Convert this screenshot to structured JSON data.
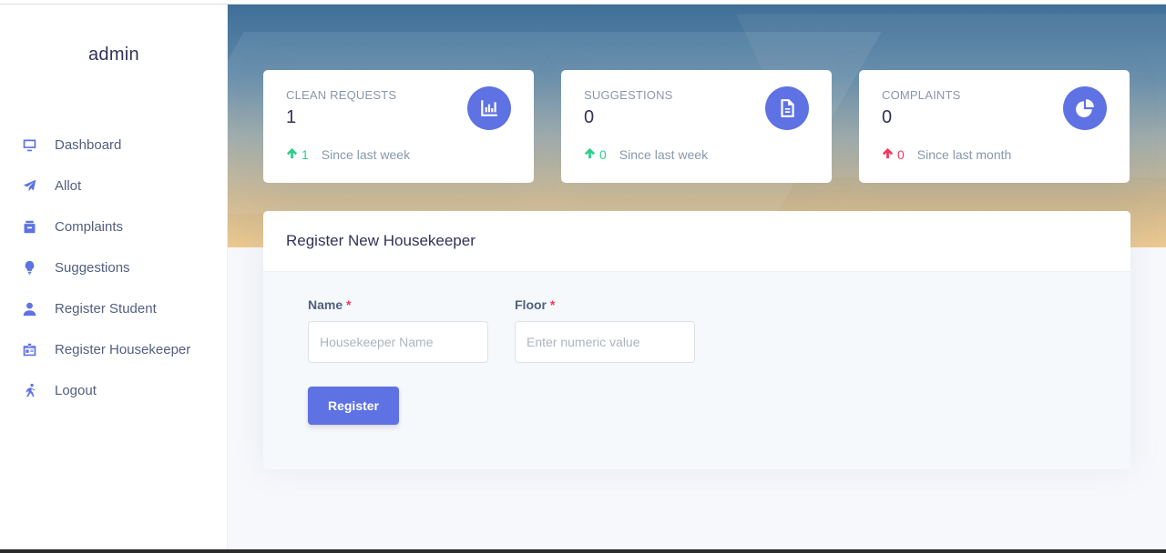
{
  "sidebar": {
    "brand": "admin",
    "items": [
      {
        "label": "Dashboard",
        "icon": "monitor-icon"
      },
      {
        "label": "Allot",
        "icon": "paper-plane-icon"
      },
      {
        "label": "Complaints",
        "icon": "archive-icon"
      },
      {
        "label": "Suggestions",
        "icon": "bulb-icon"
      },
      {
        "label": "Register Student",
        "icon": "user-icon"
      },
      {
        "label": "Register Housekeeper",
        "icon": "badge-icon"
      },
      {
        "label": "Logout",
        "icon": "running-icon"
      }
    ]
  },
  "stats": [
    {
      "label": "CLEAN REQUESTS",
      "value": "1",
      "delta": "1",
      "since": "Since last week",
      "trend": "up",
      "trend_color": "#2dce89",
      "icon": "chart-bar-icon"
    },
    {
      "label": "SUGGESTIONS",
      "value": "0",
      "delta": "0",
      "since": "Since last week",
      "trend": "up",
      "trend_color": "#2dce89",
      "icon": "document-icon"
    },
    {
      "label": "COMPLAINTS",
      "value": "0",
      "delta": "0",
      "since": "Since last month",
      "trend": "up",
      "trend_color": "#f5365c",
      "icon": "pie-chart-icon"
    }
  ],
  "form": {
    "title": "Register New Housekeeper",
    "name_label": "Name",
    "name_placeholder": "Housekeeper Name",
    "floor_label": "Floor",
    "floor_placeholder": "Enter numeric value",
    "required_mark": "*",
    "submit_label": "Register"
  },
  "colors": {
    "accent": "#5e72e4",
    "success": "#2dce89",
    "danger": "#f5365c"
  }
}
